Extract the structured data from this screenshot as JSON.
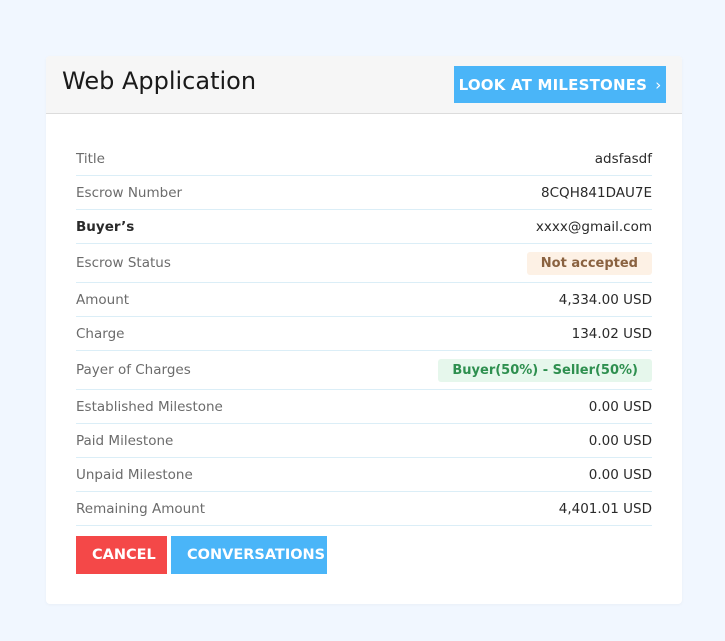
{
  "card": {
    "title": "Web Application",
    "milestones_button": "LOOK AT MILESTONES",
    "milestones_chevron": "›"
  },
  "details": [
    {
      "label": "Title",
      "value": "adsfasdf"
    },
    {
      "label": "Escrow Number",
      "value": "8CQH841DAU7E"
    },
    {
      "label": "Buyer’s",
      "value": "xxxx@gmail.com"
    },
    {
      "label": "Escrow Status",
      "value": "Not accepted"
    },
    {
      "label": "Amount",
      "value": "4,334.00 USD"
    },
    {
      "label": "Charge",
      "value": "134.02 USD"
    },
    {
      "label": "Payer of Charges",
      "value": "Buyer(50%) - Seller(50%)"
    },
    {
      "label": "Established Milestone",
      "value": "0.00 USD"
    },
    {
      "label": "Paid Milestone",
      "value": "0.00 USD"
    },
    {
      "label": "Unpaid Milestone",
      "value": "0.00 USD"
    },
    {
      "label": "Remaining Amount",
      "value": "4,401.01 USD"
    }
  ],
  "actions": {
    "cancel": "CANCEL",
    "conversations": "CONVERSATIONS"
  },
  "colors": {
    "accent": "#4ab5f8",
    "danger": "#f44848",
    "status_badge_bg": "#fdf1e5",
    "payer_badge_bg": "#e6f7ec"
  }
}
